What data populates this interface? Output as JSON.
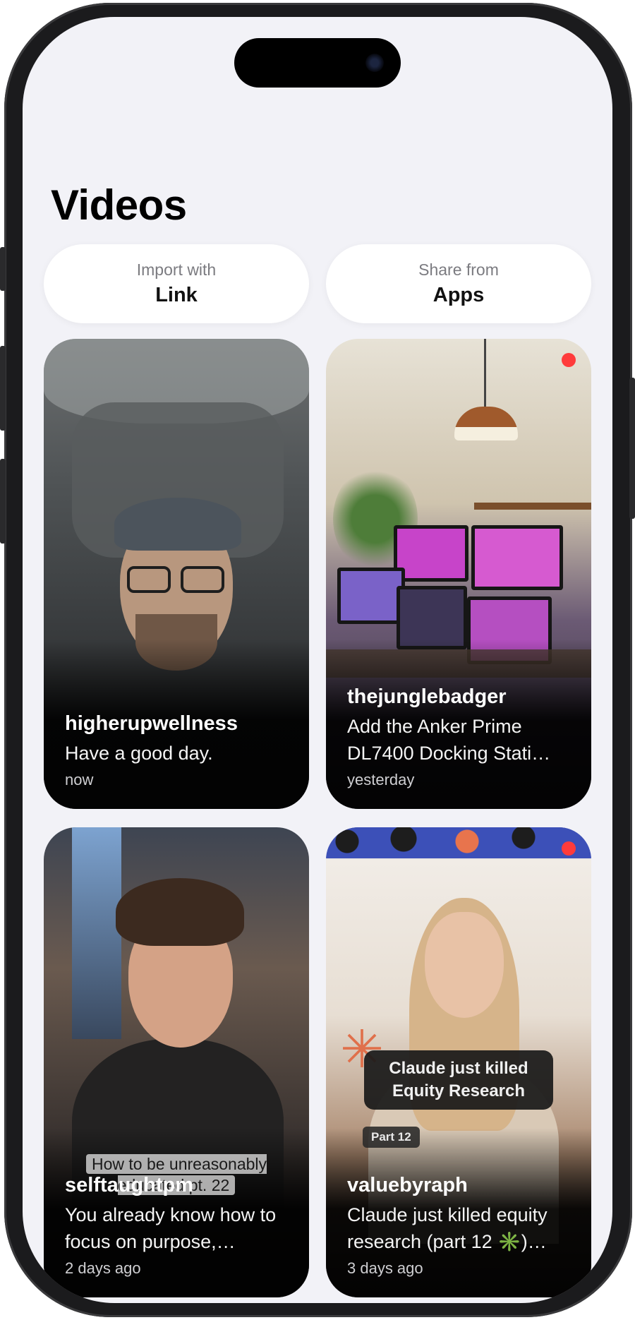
{
  "page": {
    "title": "Videos"
  },
  "actions": {
    "import": {
      "sub": "Import with",
      "main": "Link"
    },
    "share": {
      "sub": "Share from",
      "main": "Apps"
    }
  },
  "videos": [
    {
      "author": "higherupwellness",
      "caption": "Have a good day.",
      "time": "now"
    },
    {
      "author": "thejunglebadger",
      "caption": "Add the Anker Prime DL7400 Docking Stati…",
      "time": "yesterday",
      "new": true
    },
    {
      "author": "selftaughtpm",
      "caption": "You already know how to focus on purpose,…",
      "time": "2 days ago",
      "overlay": "How to be unreasonably educated pt. 22"
    },
    {
      "author": "valuebyraph",
      "caption": "Claude just killed equity research (part 12 ✳️)…",
      "time": "3 days ago",
      "new": true,
      "overlay": "Claude just killed Equity Research",
      "badge": "Part 12"
    }
  ],
  "colors": {
    "background": "#f2f2f7",
    "new_dot": "#ff3b3b"
  }
}
